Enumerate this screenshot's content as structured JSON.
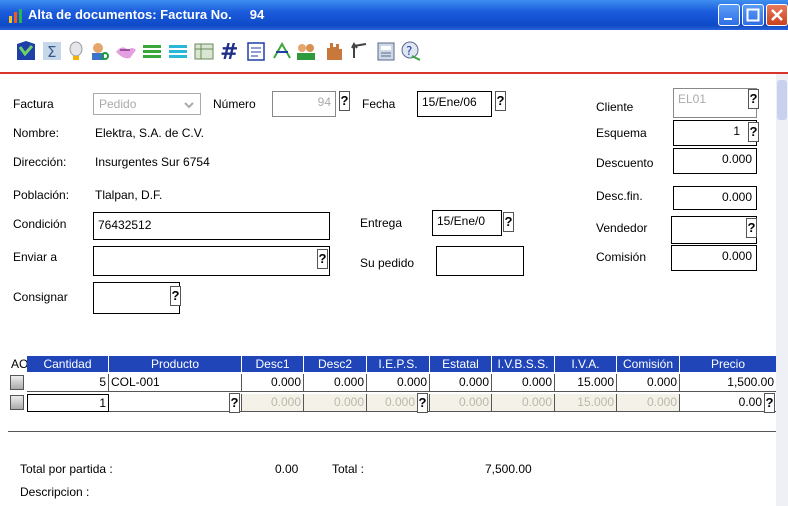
{
  "window": {
    "title": "Alta de documentos: Factura No.",
    "number": "94"
  },
  "form": {
    "factura_label": "Factura",
    "tipo_value": "Pedido",
    "numero_label": "Número",
    "numero_value": "94",
    "fecha_label": "Fecha",
    "fecha_value": "15/Ene/06",
    "cliente_label": "Cliente",
    "cliente_value": "EL01",
    "nombre_label": "Nombre:",
    "nombre_value": "Elektra, S.A. de C.V.",
    "esquema_label": "Esquema",
    "esquema_value": "1",
    "direccion_label": "Dirección:",
    "direccion_value": "Insurgentes Sur 6754",
    "descuento_label": "Descuento",
    "descuento_value": "0.000",
    "poblacion_label": "Población:",
    "poblacion_value": "Tlalpan, D.F.",
    "descfin_label": "Desc.fin.",
    "descfin_value": "0.000",
    "condicion_label": "Condición",
    "condicion_value": "76432512",
    "entrega_label": "Entrega",
    "entrega_value": "15/Ene/0",
    "vendedor_label": "Vendedor",
    "vendedor_value": "",
    "enviar_label": "Enviar a",
    "enviar_value": "",
    "supedido_label": "Su pedido",
    "supedido_value": "",
    "comision_label": "Comisión",
    "comision_value": "0.000",
    "consignar_label": "Consignar",
    "consignar_value": "",
    "help_glyph": "?"
  },
  "grid": {
    "corner_label": "AO",
    "columns": [
      "Cantidad",
      "Producto",
      "Desc1",
      "Desc2",
      "I.E.P.S.",
      "Estatal",
      "I.V.B.S.S.",
      "I.V.A.",
      "Comisión",
      "Precio"
    ],
    "rows": [
      [
        "5",
        "COL-001",
        "0.000",
        "0.000",
        "0.000",
        "0.000",
        "0.000",
        "15.000",
        "0.000",
        "1,500.00"
      ],
      [
        "1",
        "",
        "0.000",
        "0.000",
        "0.000",
        "0.000",
        "0.000",
        "15.000",
        "0.000",
        "0.00"
      ]
    ]
  },
  "totals": {
    "partida_label": "Total por partida :",
    "partida_value": "0.00",
    "total_label": "Total :",
    "total_value": "7,500.00",
    "descripcion_label": "Descripcion :"
  },
  "colors": {
    "titlebar": "#1a5bdc",
    "grid_header": "#1f45b8",
    "separator": "#d8342a"
  },
  "toolbar_icons": [
    "new-document-icon",
    "sum-icon",
    "lightbulb-icon",
    "find-person-icon",
    "handshake-icon",
    "list-icon",
    "list-alt-icon",
    "table-edit-icon",
    "hash-icon",
    "notes-icon",
    "sort-icon",
    "users-icon",
    "hand-icon",
    "undo-icon",
    "calculator-icon",
    "help-icon"
  ]
}
